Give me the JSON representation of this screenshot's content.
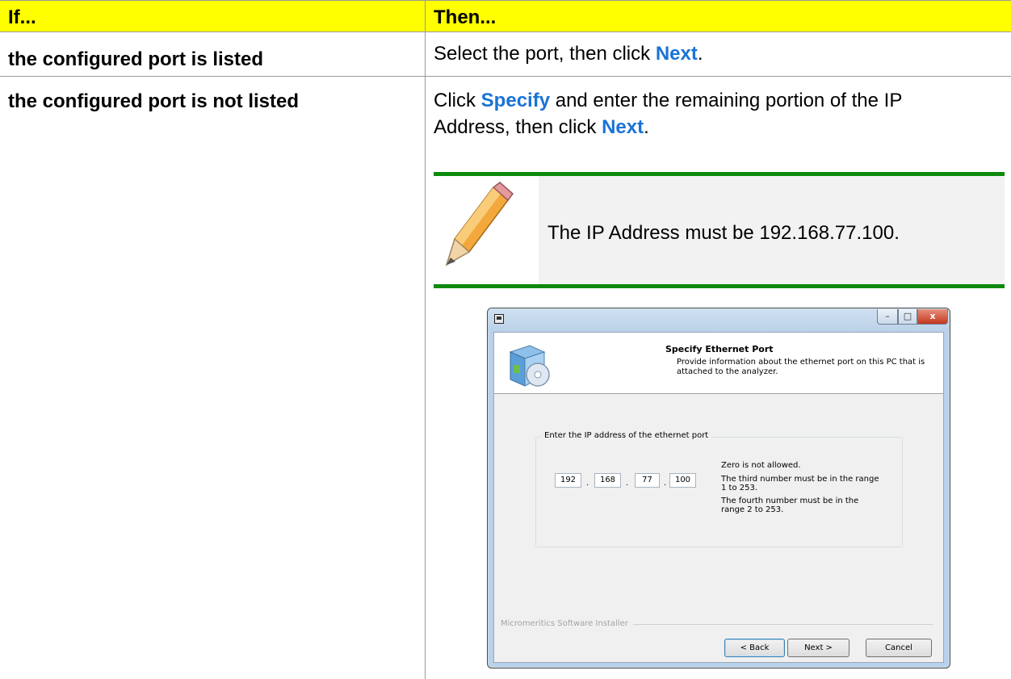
{
  "table": {
    "header": {
      "if": "If...",
      "then": "Then..."
    },
    "rows": [
      {
        "condition": "the configured port is listed",
        "action": {
          "pre": "Select the port, then click ",
          "keyword": "Next",
          "post": "."
        }
      },
      {
        "condition": "the configured port is not listed",
        "action": {
          "pre": "Click ",
          "keyword1": "Specify",
          "mid": " and enter the remaining portion of the IP Address, then click ",
          "keyword2": "Next",
          "post": "."
        }
      }
    ]
  },
  "note": {
    "icon": "pencil-icon",
    "text": "The IP Address must be 192.168.77.100."
  },
  "dialog": {
    "banner_title": "Specify Ethernet Port",
    "banner_subtitle": "Provide information about the ethernet port on this PC that is attached to the analyzer.",
    "group_label": "Enter the IP address of the ethernet port",
    "ip": [
      "192",
      "168",
      "77",
      "100"
    ],
    "ip_separator": ".",
    "hints": [
      "Zero is not allowed.",
      "The third number must be in the range 1 to 253.",
      "The fourth number must be in the range 2 to 253."
    ],
    "footer_label": "Micromeritics Software Installer",
    "buttons": {
      "back": "< Back",
      "next": "Next >",
      "cancel": "Cancel"
    },
    "window_buttons": {
      "minimize": "–",
      "maximize": "□",
      "close": "x"
    }
  },
  "colors": {
    "header_bg": "#ffff00",
    "keyword": "#1a73d6",
    "note_rule": "#0d8a0d",
    "note_bg": "#f2f2f2"
  }
}
